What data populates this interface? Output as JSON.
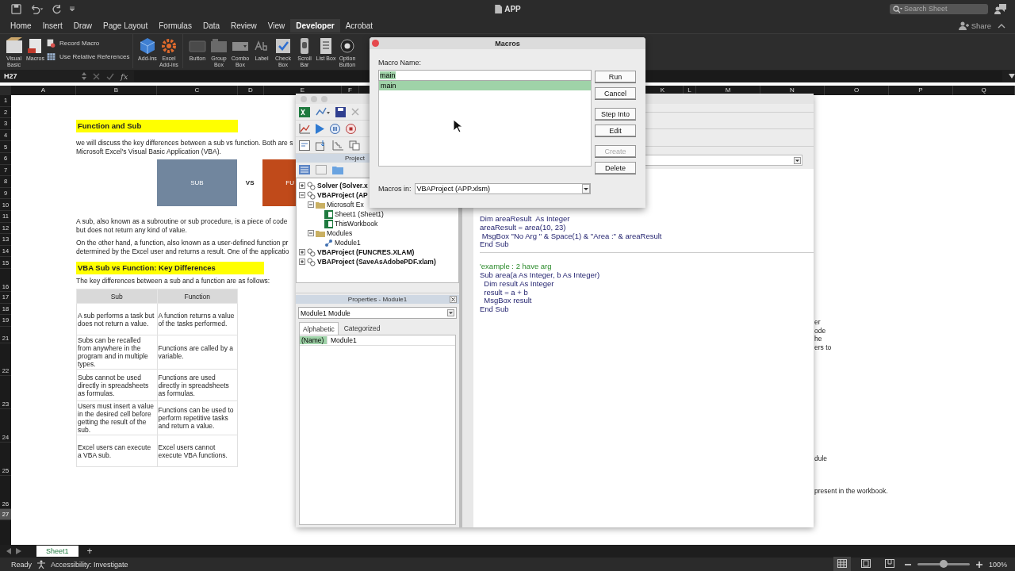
{
  "title_bar": {
    "title": "APP",
    "search": {
      "placeholder": "Search Sheet"
    }
  },
  "tabs": [
    {
      "label": "Home",
      "selected": false
    },
    {
      "label": "Insert",
      "selected": false
    },
    {
      "label": "Draw",
      "selected": false
    },
    {
      "label": "Page Layout",
      "selected": false
    },
    {
      "label": "Formulas",
      "selected": false
    },
    {
      "label": "Data",
      "selected": false
    },
    {
      "label": "Review",
      "selected": false
    },
    {
      "label": "View",
      "selected": false
    },
    {
      "label": "Developer",
      "selected": true
    },
    {
      "label": "Acrobat",
      "selected": false
    }
  ],
  "share": {
    "label": "Share"
  },
  "ribbon": {
    "groups": [
      {
        "items": [
          {
            "label": "Visual Basic",
            "kind": "large"
          },
          {
            "label": "Macros",
            "kind": "large"
          },
          {
            "label": "Record Macro",
            "kind": "small"
          },
          {
            "label": "Use Relative References",
            "kind": "small"
          }
        ]
      },
      {
        "items": [
          {
            "label": "Add-ins",
            "kind": "large"
          },
          {
            "label": "Excel Add-ins",
            "kind": "large"
          }
        ]
      },
      {
        "items": [
          {
            "label": "Button",
            "kind": "large"
          },
          {
            "label": "Group Box",
            "kind": "large"
          },
          {
            "label": "Combo Box",
            "kind": "large"
          },
          {
            "label": "Label",
            "kind": "large"
          },
          {
            "label": "Check Box",
            "kind": "large"
          },
          {
            "label": "Scroll Bar",
            "kind": "large"
          },
          {
            "label": "List Box",
            "kind": "large"
          },
          {
            "label": "Option Button",
            "kind": "large"
          }
        ]
      }
    ]
  },
  "formula_bar": {
    "name_box": "H27",
    "fx": "fx"
  },
  "sheet": {
    "columns": [
      "A",
      "B",
      "C",
      "D",
      "E",
      "F",
      "K",
      "L",
      "M",
      "N",
      "O",
      "P",
      "Q"
    ],
    "rows": [
      {
        "label": "1",
        "selected": false
      },
      {
        "label": "2",
        "selected": false
      },
      {
        "label": "3",
        "selected": false
      },
      {
        "label": "4",
        "selected": false
      },
      {
        "label": "5",
        "selected": false
      },
      {
        "label": "6",
        "selected": false
      },
      {
        "label": "7",
        "selected": false
      },
      {
        "label": "8",
        "selected": false
      },
      {
        "label": "9",
        "selected": false
      },
      {
        "label": "10",
        "selected": false
      },
      {
        "label": "11",
        "selected": false
      },
      {
        "label": "12",
        "selected": false
      },
      {
        "label": "13",
        "selected": false
      },
      {
        "label": "14",
        "selected": false
      },
      {
        "label": "15",
        "selected": false
      },
      {
        "label": "16",
        "selected": false
      },
      {
        "label": "17",
        "selected": false
      },
      {
        "label": "18",
        "selected": false
      },
      {
        "label": "19",
        "selected": false
      },
      {
        "label": "21",
        "selected": false
      },
      {
        "label": "22",
        "selected": false
      },
      {
        "label": "23",
        "selected": false
      },
      {
        "label": "24",
        "selected": false
      },
      {
        "label": "25",
        "selected": false
      },
      {
        "label": "26",
        "selected": false
      },
      {
        "label": "27",
        "selected": true
      }
    ],
    "heading_1": "Function and Sub",
    "paragraph_1": [
      "we will discuss the key differences between a sub vs function. Both are s",
      "Microsoft Excel's Visual Basic Application (VBA)."
    ],
    "sub_box": "SUB",
    "vs": "VS",
    "function_box": "FU",
    "paragraph_2": [
      "A sub, also known as a subroutine or sub procedure, is a piece of code",
      "but does not return any kind of value."
    ],
    "paragraph_3": [
      "On the other hand, a function, also known as a user-defined function pr",
      "determined by the Excel user and returns a result. One of the applicatio"
    ],
    "heading_2": "VBA Sub vs Function: Key Differences",
    "intro": "The key differences between a sub and a function are as follows:",
    "table": {
      "columns": [
        "Sub",
        "Function"
      ],
      "rows": [
        [
          "A sub performs a task but does not return a value.",
          "A function returns a value of the tasks performed."
        ],
        [
          "Subs can be recalled from anywhere in the program and in multiple types.",
          "Functions are called by a variable."
        ],
        [
          "Subs cannot be used directly in spreadsheets as formulas.",
          "Functions are used directly in spreadsheets as formulas."
        ],
        [
          "Users must insert a value in the desired cell before getting the result of the sub.",
          "Functions can be used to perform repetitive tasks and return a value."
        ],
        [
          "Excel users can execute a VBA sub.",
          "Excel users cannot execute VBA functions."
        ]
      ]
    },
    "right_fragments": [
      [
        "er",
        "ode",
        "he",
        "ers to"
      ],
      [
        "dule"
      ],
      [
        "present in the workbook."
      ]
    ]
  },
  "sheet_tabs": {
    "sheets": [
      {
        "label": "Sheet1",
        "selected": true
      }
    ],
    "add": "+"
  },
  "status_bar": {
    "ready": "Ready",
    "accessibility": "Accessibility: Investigate",
    "views": [
      {
        "selected": true
      },
      {
        "selected": false
      },
      {
        "selected": false
      }
    ],
    "zoom_slider": {
      "level": 0.5
    },
    "zoom": "100%"
  },
  "vba_editor": {
    "project_title": "Project",
    "tree": [
      {
        "label": "Solver (Solver.x",
        "kind": "project",
        "expanded": false
      },
      {
        "label": "VBAProject (AP",
        "kind": "project",
        "expanded": true,
        "children": [
          {
            "label": "Microsoft Ex",
            "kind": "folder",
            "expanded": true,
            "children": [
              {
                "label": "Sheet1 (Sheet1)",
                "kind": "sheet"
              },
              {
                "label": "ThisWorkbook",
                "kind": "sheet"
              }
            ]
          },
          {
            "label": "Modules",
            "kind": "folder",
            "expanded": true,
            "children": [
              {
                "label": "Module1",
                "kind": "module"
              }
            ]
          }
        ]
      },
      {
        "label": "VBAProject (FUNCRES.XLAM)",
        "kind": "project",
        "expanded": false
      },
      {
        "label": "VBAProject (SaveAsAdobePDF.xlam)",
        "kind": "project",
        "expanded": false
      }
    ],
    "properties": {
      "title": "Properties - Module1",
      "object": "Module1 Module",
      "tabs": [
        {
          "label": "Alphabetic",
          "selected": true
        },
        {
          "label": "Categorized",
          "selected": false
        }
      ],
      "rows": [
        {
          "name": "(Name)",
          "value": "Module1",
          "selected": true
        }
      ]
    },
    "code": [
      {
        "lines": [
          {
            "text": "Dim areaResult  As Integer",
            "kind": "code"
          },
          {
            "text": "areaResult = area(10, 23)",
            "kind": "code"
          },
          {
            "text": " MsgBox \"No Arg \" & Space(1) & \"Area :\" & areaResult",
            "kind": "code"
          },
          {
            "text": "End Sub",
            "kind": "code"
          }
        ]
      },
      {
        "lines": [
          {
            "text": "'example : 2 have arg",
            "kind": "comment"
          },
          {
            "text": "Sub area(a As Integer, b As Integer)",
            "kind": "code"
          },
          {
            "text": "  Dim result As Integer",
            "kind": "code"
          },
          {
            "text": "  result = a + b",
            "kind": "code"
          },
          {
            "text": "  MsgBox result",
            "kind": "code"
          },
          {
            "text": "End Sub",
            "kind": "code"
          }
        ]
      }
    ]
  },
  "macros_dialog": {
    "title": "Macros",
    "name_label": "Macro Name:",
    "name_value": "main",
    "macros": [
      {
        "label": "main",
        "selected": true
      }
    ],
    "buttons": [
      {
        "label": "Run",
        "disabled": false
      },
      {
        "label": "Cancel",
        "disabled": false
      },
      {
        "label": "Step Into",
        "disabled": false
      },
      {
        "label": "Edit",
        "disabled": false
      },
      {
        "label": "Create",
        "disabled": true
      },
      {
        "label": "Delete",
        "disabled": false
      }
    ],
    "in_label": "Macros in:",
    "in_value": "VBAProject (APP.xlsm)"
  }
}
